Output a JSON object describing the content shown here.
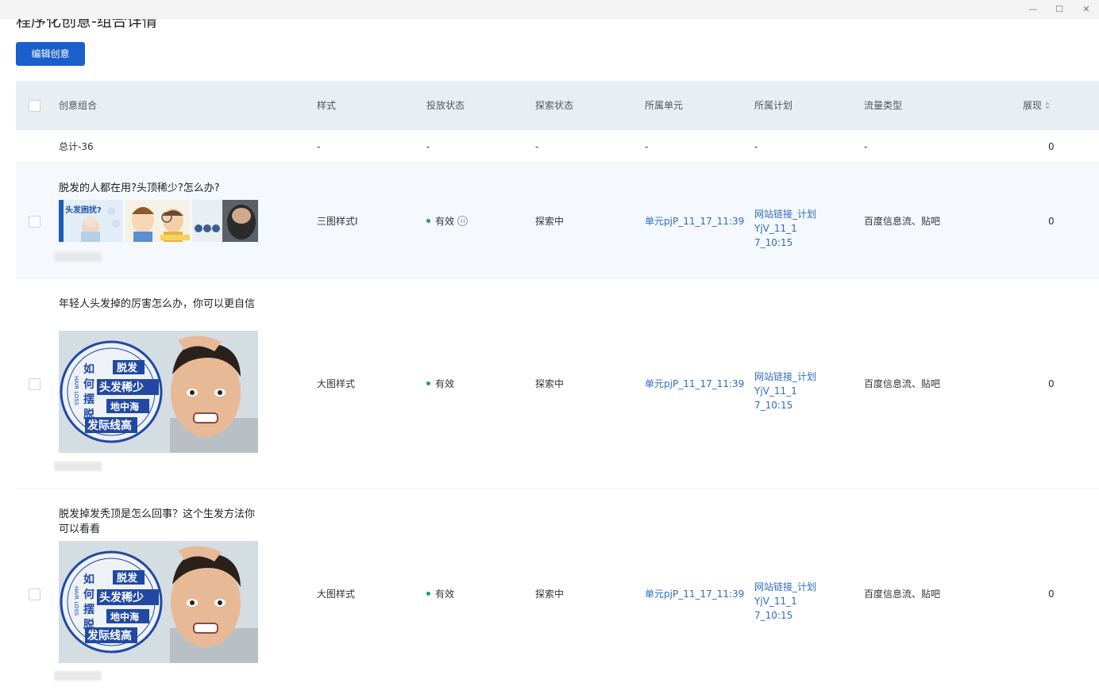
{
  "page": {
    "title": "程序化创意-组合详情"
  },
  "toolbar": {
    "edit_label": "编辑创意"
  },
  "window": {
    "minimize": "—",
    "maximize": "☐",
    "close": "✕"
  },
  "table": {
    "columns": [
      "创意组合",
      "样式",
      "投放状态",
      "探索状态",
      "所属单元",
      "所属计划",
      "流量类型",
      "展现"
    ],
    "total": {
      "label": "总计-36",
      "style": "-",
      "status": "-",
      "explore": "-",
      "unit": "-",
      "plan": "-",
      "traffic": "-",
      "impressions": "0"
    },
    "rows": [
      {
        "title": "脱发的人都在用?头顶稀少?怎么办?",
        "style": "三图样式I",
        "status": "有效",
        "explore": "探索中",
        "unit": "单元pjP_11_17_11:39",
        "plan_line1": "网站链接_计划YjV_11_1",
        "plan_line2": "7_10:15",
        "traffic": "百度信息流、贴吧",
        "impressions": "0"
      },
      {
        "title": "年轻人头发掉的厉害怎么办，你可以更自信",
        "style": "大图样式",
        "status": "有效",
        "explore": "探索中",
        "unit": "单元pjP_11_17_11:39",
        "plan_line1": "网站链接_计划YjV_11_1",
        "plan_line2": "7_10:15",
        "traffic": "百度信息流、贴吧",
        "impressions": "0"
      },
      {
        "title": "脱发掉发秃顶是怎么回事？这个生发方法你可以看看",
        "style": "大图样式",
        "status": "有效",
        "explore": "探索中",
        "unit": "单元pjP_11_17_11:39",
        "plan_line1": "网站链接_计划YjV_11_1",
        "plan_line2": "7_10:15",
        "traffic": "百度信息流、贴吧",
        "impressions": "0"
      }
    ]
  },
  "image_text": {
    "badge_left": [
      "如",
      "何",
      "摆",
      "脱"
    ],
    "badge_ring": "HAIR LOSS",
    "badge_lines": [
      "脱发",
      "头发稀少",
      "地中海",
      "发际线高"
    ],
    "small_1": "头发困扰?"
  }
}
